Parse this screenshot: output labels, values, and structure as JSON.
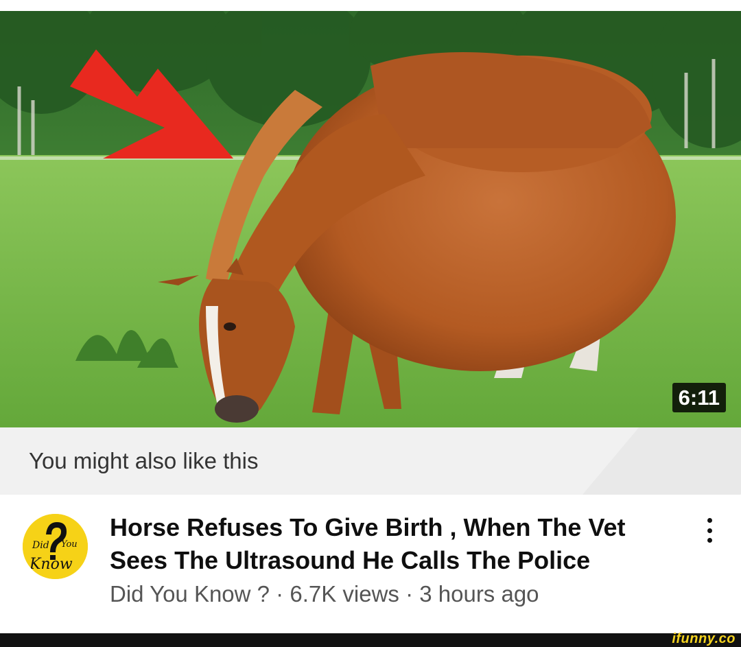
{
  "video": {
    "thumbnail_subject": "pregnant-horse-grazing",
    "duration": "6:11",
    "title_line1": "Horse Refuses To Give Birth , When The Vet",
    "title_line2": "Sees The Ultrasound He Calls The Police",
    "meta": "Did You Know ? · 6.7K views · 3 hours ago"
  },
  "banner": {
    "text": "You might also like this"
  },
  "channel": {
    "avatar_logo_text": "Did You Know",
    "avatar_color": "#f6d217"
  },
  "menu": {
    "icon": "more-vert-icon"
  },
  "watermark": {
    "text": "ifunny.co",
    "color": "#f4d21e"
  },
  "colors": {
    "arrow": "#e8291f",
    "horse": "#b8602a",
    "grass": "#6fb046"
  }
}
